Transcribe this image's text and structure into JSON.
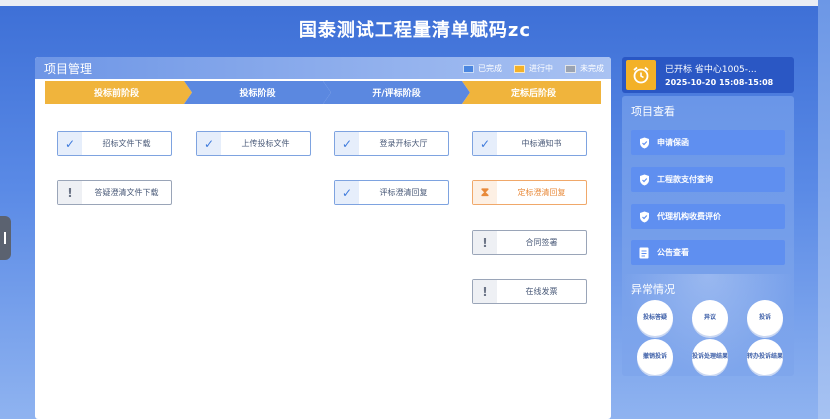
{
  "app_title": "国泰测试工程量清单赋码zc",
  "project_panel": {
    "title": "项目管理",
    "legend": [
      {
        "label": "已完成",
        "color": "#4a86e0"
      },
      {
        "label": "进行中",
        "color": "#f3b128"
      },
      {
        "label": "未完成",
        "color": "#9aa3b2"
      }
    ]
  },
  "stages": [
    {
      "label": "投标前阶段",
      "color": "#f0b43c"
    },
    {
      "label": "投标阶段",
      "color": "#5b88e0"
    },
    {
      "label": "开/评标阶段",
      "color": "#5b88e0"
    },
    {
      "label": "定标后阶段",
      "color": "#f0b43c"
    }
  ],
  "tasks": {
    "col1": [
      {
        "label": "招标文件下载",
        "status": "done",
        "icon": "check-icon"
      },
      {
        "label": "答疑澄清文件下载",
        "status": "todo",
        "icon": "exclamation-icon"
      }
    ],
    "col2": [
      {
        "label": "上传投标文件",
        "status": "done",
        "icon": "check-icon"
      }
    ],
    "col3": [
      {
        "label": "登录开标大厅",
        "status": "done",
        "icon": "check-icon"
      },
      {
        "label": "评标澄清回复",
        "status": "done",
        "icon": "check-icon"
      }
    ],
    "col4": [
      {
        "label": "中标通知书",
        "status": "done",
        "icon": "check-icon"
      },
      {
        "label": "定标澄清回复",
        "status": "in-progress",
        "icon": "hourglass-icon"
      },
      {
        "label": "合同签署",
        "status": "todo",
        "icon": "exclamation-icon"
      },
      {
        "label": "在线发票",
        "status": "todo",
        "icon": "exclamation-icon"
      }
    ]
  },
  "alarm": {
    "line1": "已开标 省中心1005-...",
    "line2": "2025-10-20 15:08-15:08",
    "icon": "alarm-clock-icon"
  },
  "query": {
    "title": "项目查看",
    "items": [
      {
        "label": "申请保函",
        "icon": "shield-icon"
      },
      {
        "label": "工程款支付查询",
        "icon": "shield-icon"
      },
      {
        "label": "代理机构收费评价",
        "icon": "shield-icon"
      },
      {
        "label": "公告查看",
        "icon": "document-icon"
      }
    ]
  },
  "abnormal": {
    "title": "异常情况",
    "items": [
      "投标答疑",
      "异议",
      "投诉",
      "撤销投诉",
      "投诉处理结果",
      "转办投诉结果"
    ]
  }
}
